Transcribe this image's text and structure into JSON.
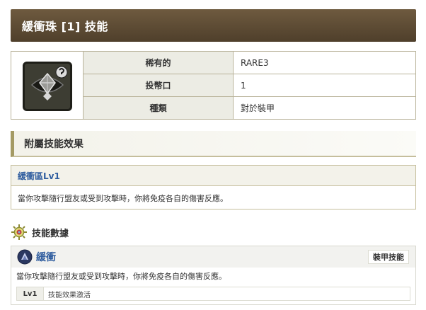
{
  "header": {
    "title": "緩衝珠 [1] 技能"
  },
  "info": {
    "icon": "decoration-jewel-icon",
    "rows": [
      {
        "label": "稀有的",
        "value": "RARE3"
      },
      {
        "label": "投幣口",
        "value": "1"
      },
      {
        "label": "種類",
        "value": "對於裝甲"
      }
    ]
  },
  "effects_section": {
    "title": "附屬技能效果",
    "skill_name": "緩衝區Lv1",
    "description": "當你攻擊隨行盟友或受到攻擊時，你將免疫各自的傷害反應。"
  },
  "skill_data_section": {
    "title": "技能數據",
    "icon": "sun-gear-icon"
  },
  "skill_card": {
    "icon": "armor-skill-icon",
    "name": "緩衝",
    "badge": "裝甲技能",
    "description": "當你攻擊隨行盟友或受到攻擊時，你將免疫各自的傷害反應。",
    "levels": [
      {
        "level": "Lv1",
        "text": "技能效果激活"
      }
    ]
  },
  "colors": {
    "header_bg": "#5e4c35",
    "accent_border": "#a49a64",
    "skill_link": "#2f5d9f",
    "table_label_bg": "#ecece4"
  }
}
